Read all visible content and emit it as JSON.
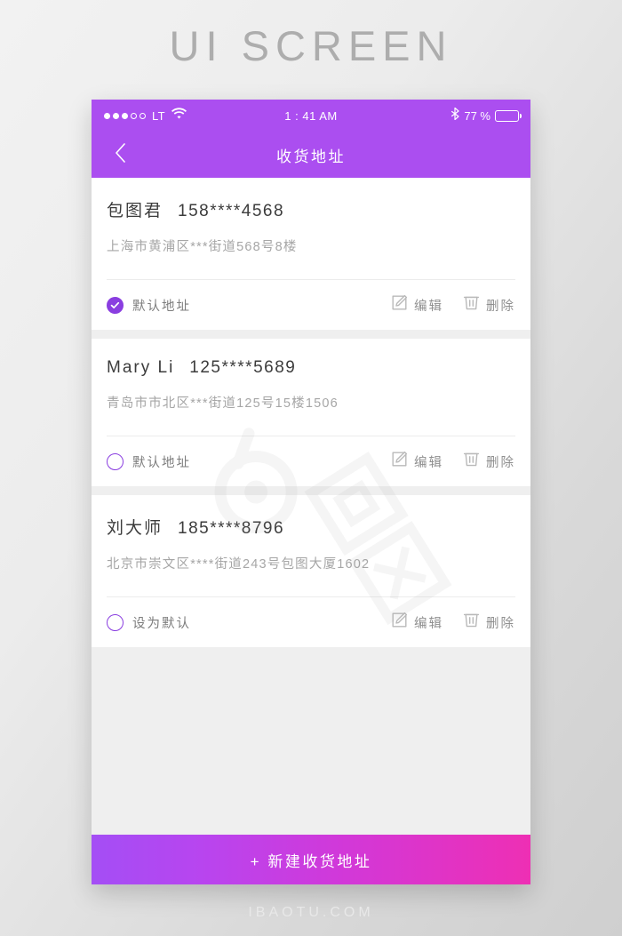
{
  "page": {
    "heading": "UI SCREEN",
    "footer": "IBAOTU.COM"
  },
  "colors": {
    "header_purple": "#ab4ef0",
    "accent_purple": "#8a3ee0",
    "cta_gradient_start": "#a44ef5",
    "cta_gradient_end": "#ee2fb4",
    "page_background": "#efefef"
  },
  "status_bar": {
    "carrier": "LT",
    "signal_filled": 3,
    "signal_total": 5,
    "wifi_icon": "wifi-icon",
    "time": "1 : 41 AM",
    "bluetooth_icon": "bluetooth-icon",
    "battery_percent": "77 %",
    "battery_level": 77
  },
  "nav": {
    "back_icon": "chevron-left-icon",
    "title": "收货地址"
  },
  "addresses": [
    {
      "name": "包图君",
      "phone": "158****4568",
      "detail": "上海市黄浦区***街道568号8楼",
      "is_default": true,
      "default_label": "默认地址",
      "edit_label": "编辑",
      "delete_label": "删除"
    },
    {
      "name": "Mary Li",
      "phone": "125****5689",
      "detail": "青岛市市北区***街道125号15楼1506",
      "is_default": false,
      "default_label": "默认地址",
      "edit_label": "编辑",
      "delete_label": "删除"
    },
    {
      "name": "刘大师",
      "phone": "185****8796",
      "detail": "北京市崇文区****街道243号包图大厦1602",
      "is_default": false,
      "default_label": "设为默认",
      "edit_label": "编辑",
      "delete_label": "删除"
    }
  ],
  "cta": {
    "label": "+ 新建收货地址"
  }
}
